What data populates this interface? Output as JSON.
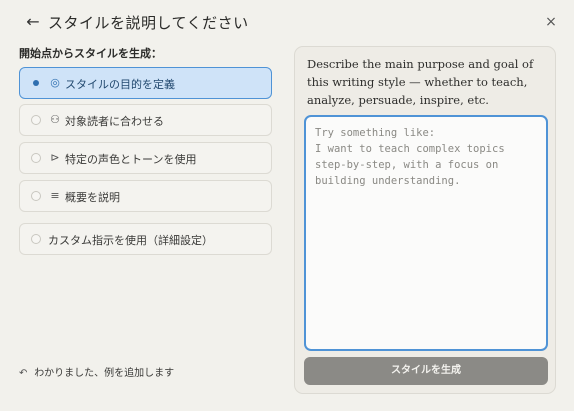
{
  "header": {
    "back_icon": "←",
    "title": "スタイルを説明してください",
    "close_icon": "×"
  },
  "left": {
    "heading": "開始点からスタイルを生成：",
    "options": [
      {
        "icon": "◎",
        "icon_name": "target-icon",
        "label": "スタイルの目的を定義",
        "selected": true
      },
      {
        "icon": "⚇",
        "icon_name": "people-icon",
        "label": "対象読者に合わせる",
        "selected": false
      },
      {
        "icon": "⊳",
        "icon_name": "speaker-icon",
        "label": "特定の声色とトーンを使用",
        "selected": false
      },
      {
        "icon": "≡",
        "icon_name": "list-icon",
        "label": "概要を説明",
        "selected": false
      },
      {
        "icon": "",
        "icon_name": "",
        "label": "カスタム指示を使用（詳細設定）",
        "selected": false
      }
    ],
    "footer_icon": "↶",
    "footer_text": "わかりました、例を追加します"
  },
  "right": {
    "description": "Describe the main purpose and goal of this writing style — whether to teach, analyze, persuade, inspire, etc.",
    "placeholder": "Try something like:\nI want to teach complex topics step-by-step, with a focus on building understanding.",
    "button_label": "スタイルを生成"
  },
  "colors": {
    "accent": "#4f93d6",
    "selected_bg": "#cfe3f8",
    "button_bg": "#8b8a86",
    "background": "#f2f1ec"
  }
}
